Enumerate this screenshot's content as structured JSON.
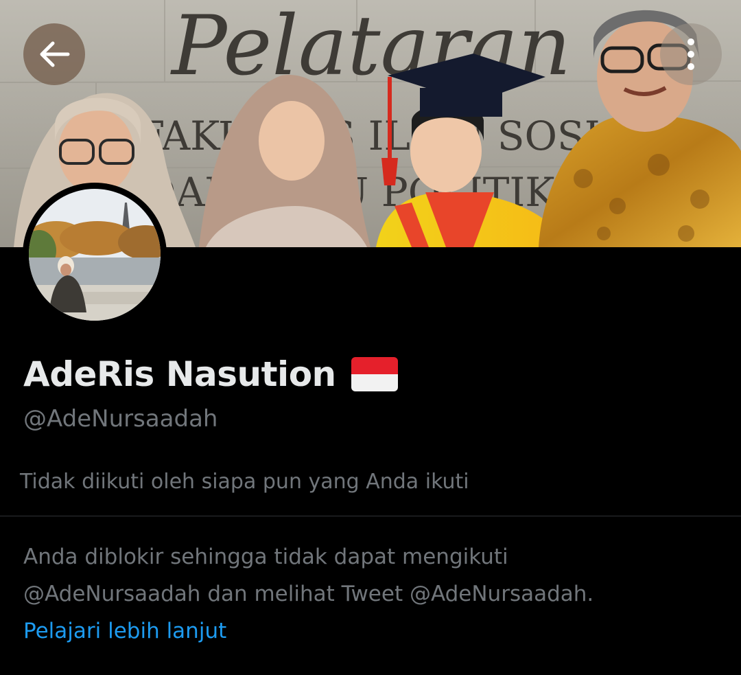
{
  "header": {
    "back_icon": "arrow-left-icon",
    "more_icon": "vertical-ellipsis-icon",
    "banner_sign_line1": "Pelataran",
    "banner_sign_line2": "FAKULTAS ILMU SOSIAL",
    "banner_sign_line3": "DAN ILMU POLITIK"
  },
  "profile": {
    "display_name": "AdeRis Nasution",
    "flag_icon": "indonesia-flag-icon",
    "handle": "@AdeNursaadah",
    "followed_note": "Tidak diikuti oleh siapa pun yang Anda ikuti"
  },
  "blocked": {
    "line1": "Anda diblokir sehingga tidak dapat mengikuti",
    "line2": "@AdeNursaadah dan melihat Tweet @AdeNursaadah.",
    "learn_more": "Pelajari lebih lanjut"
  },
  "colors": {
    "background": "#000000",
    "primary_text": "#e7e9ea",
    "secondary_text": "#71767b",
    "link": "#1d9bf0",
    "divider": "#2f3336",
    "flag_red": "#e5202b",
    "flag_white": "#f2f2f2"
  }
}
